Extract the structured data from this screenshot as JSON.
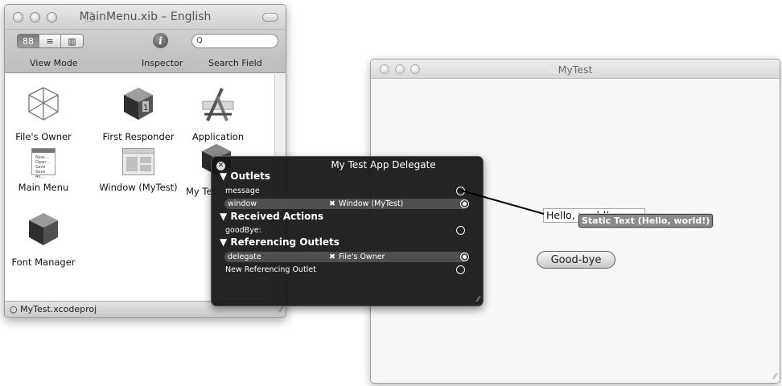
{
  "xib_window": {
    "title": "MainMenu.xib – English",
    "toolbar": {
      "view_mode_label": "View Mode",
      "view_mode_segments": [
        "88",
        "≡",
        "▥"
      ],
      "inspector_label": "Inspector",
      "inspector_glyph": "i",
      "search_label": "Search Field",
      "search_value": "",
      "search_glyph": "Q"
    },
    "objects": [
      {
        "label": "File's Owner",
        "icon": "wireframe-cube-icon"
      },
      {
        "label": "First Responder",
        "icon": "first-responder-cube-icon"
      },
      {
        "label": "Application",
        "icon": "application-icon"
      },
      {
        "label": "Main Menu",
        "icon": "main-menu-icon"
      },
      {
        "label": "Window (MyTest)",
        "icon": "window-icon"
      },
      {
        "label": "My Tes",
        "icon": "app-delegate-cube-icon"
      },
      {
        "label": "Font Manager",
        "icon": "font-manager-cube-icon"
      }
    ],
    "menu_icon_lines": [
      "New...",
      "Open...",
      "Save",
      "Save As..."
    ],
    "status": "MyTest.xcodeproj"
  },
  "mytest_window": {
    "title": "MyTest",
    "text_field_value": "Hello, world!",
    "static_text_tooltip": "Static Text (Hello, world!)",
    "button_label": "Good-bye"
  },
  "hud": {
    "title": "My Test App Delegate",
    "close_glyph": "✕",
    "outlets_header": "▼ Outlets",
    "outlets": [
      {
        "name": "message",
        "target": ""
      },
      {
        "name": "window",
        "target": "Window (MyTest)"
      }
    ],
    "actions_header": "▼ Received Actions",
    "actions": [
      {
        "name": "goodBye:",
        "target": ""
      }
    ],
    "referencing_header": "▼ Referencing Outlets",
    "referencing": [
      {
        "name": "delegate",
        "target": "File's Owner"
      },
      {
        "name": "New Referencing Outlet",
        "target": ""
      }
    ],
    "target_glyph": "✖"
  },
  "colors": {
    "hud_background": "#161616",
    "hud_row_bar": "#4f4f4f",
    "window_background": "#f4f4f4"
  }
}
